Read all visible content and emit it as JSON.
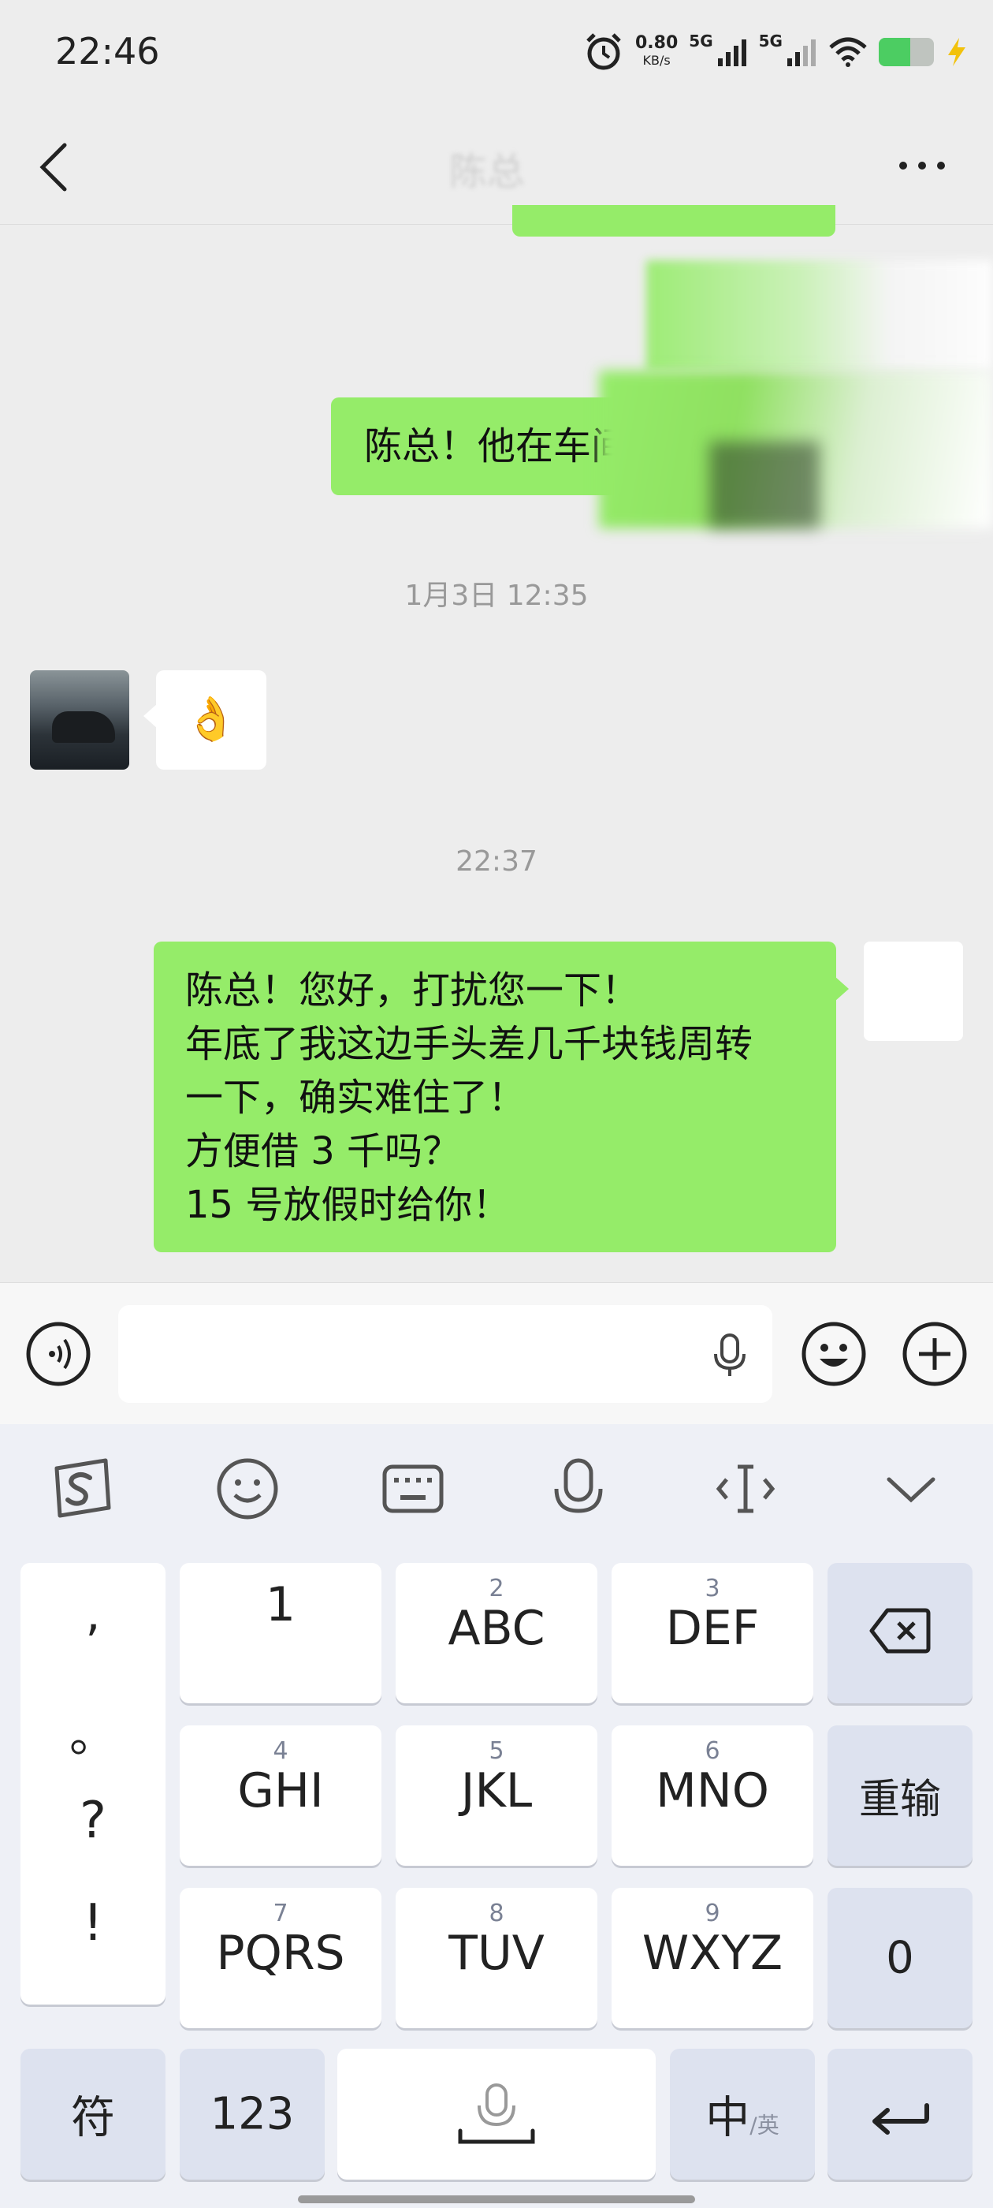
{
  "status_bar": {
    "time": "22:46",
    "net_speed_value": "0.80",
    "net_speed_unit": "KB/s",
    "signal_1_label": "5G",
    "signal_2_label": "5G"
  },
  "header": {
    "title": "陈总"
  },
  "messages": {
    "sent_partial_text": "陈总！他在车间",
    "timestamp_1": "1月3日 12:35",
    "received_emoji": "👌",
    "timestamp_2": "22:37",
    "sent_main_lines": [
      "陈总！您好，打扰您一下！",
      "年底了我这边手头差几千块钱周转",
      "一下，确实难住了！",
      "方便借 3 千吗？",
      "15 号放假时给你！"
    ]
  },
  "input": {
    "value": "",
    "placeholder": ""
  },
  "keyboard": {
    "punct": [
      ",",
      "。",
      "?",
      "!"
    ],
    "keys": {
      "k1": {
        "num": "",
        "label": "1"
      },
      "k2": {
        "num": "2",
        "label": "ABC"
      },
      "k3": {
        "num": "3",
        "label": "DEF"
      },
      "k4": {
        "num": "4",
        "label": "GHI"
      },
      "k5": {
        "num": "5",
        "label": "JKL"
      },
      "k6": {
        "num": "6",
        "label": "MNO"
      },
      "k7": {
        "num": "7",
        "label": "PQRS"
      },
      "k8": {
        "num": "8",
        "label": "TUV"
      },
      "k9": {
        "num": "9",
        "label": "WXYZ"
      }
    },
    "reenter_label": "重输",
    "zero_label": "0",
    "symbol_label": "符",
    "num_label": "123",
    "lang_main": "中",
    "lang_sub": "/英"
  },
  "colors": {
    "sent_bubble": "#95ec69",
    "received_bubble": "#ffffff",
    "background": "#ededed"
  }
}
